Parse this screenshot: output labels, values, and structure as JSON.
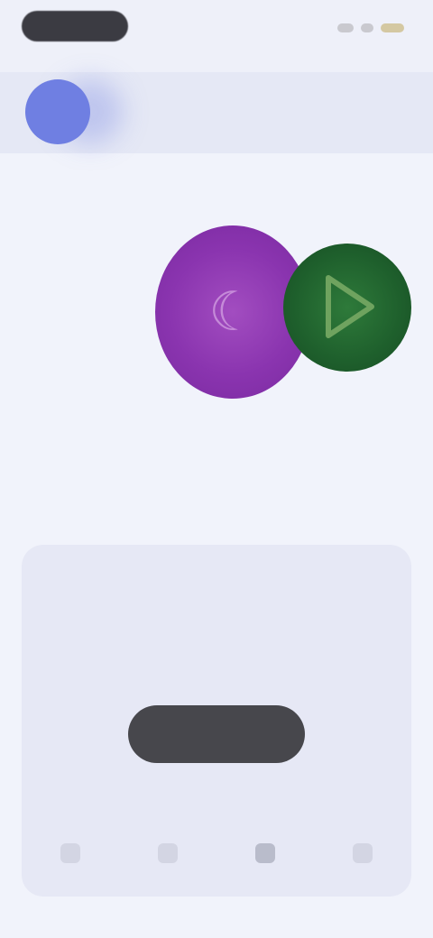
{
  "hero": {
    "title": "",
    "subtitle": ""
  },
  "card": {
    "tag": "",
    "title": "",
    "description": "",
    "cta_label": ""
  },
  "nav": {
    "items": [
      {
        "label": ""
      },
      {
        "label": ""
      },
      {
        "label": ""
      },
      {
        "label": ""
      }
    ]
  },
  "icons": {
    "avatar": "profile-avatar",
    "hero_left": "brand-circle-purple",
    "hero_right": "play-icon"
  },
  "colors": {
    "accent": "#6d73e0",
    "purple": "#8a34af",
    "green": "#1e5f2c",
    "button": "#47474c"
  }
}
